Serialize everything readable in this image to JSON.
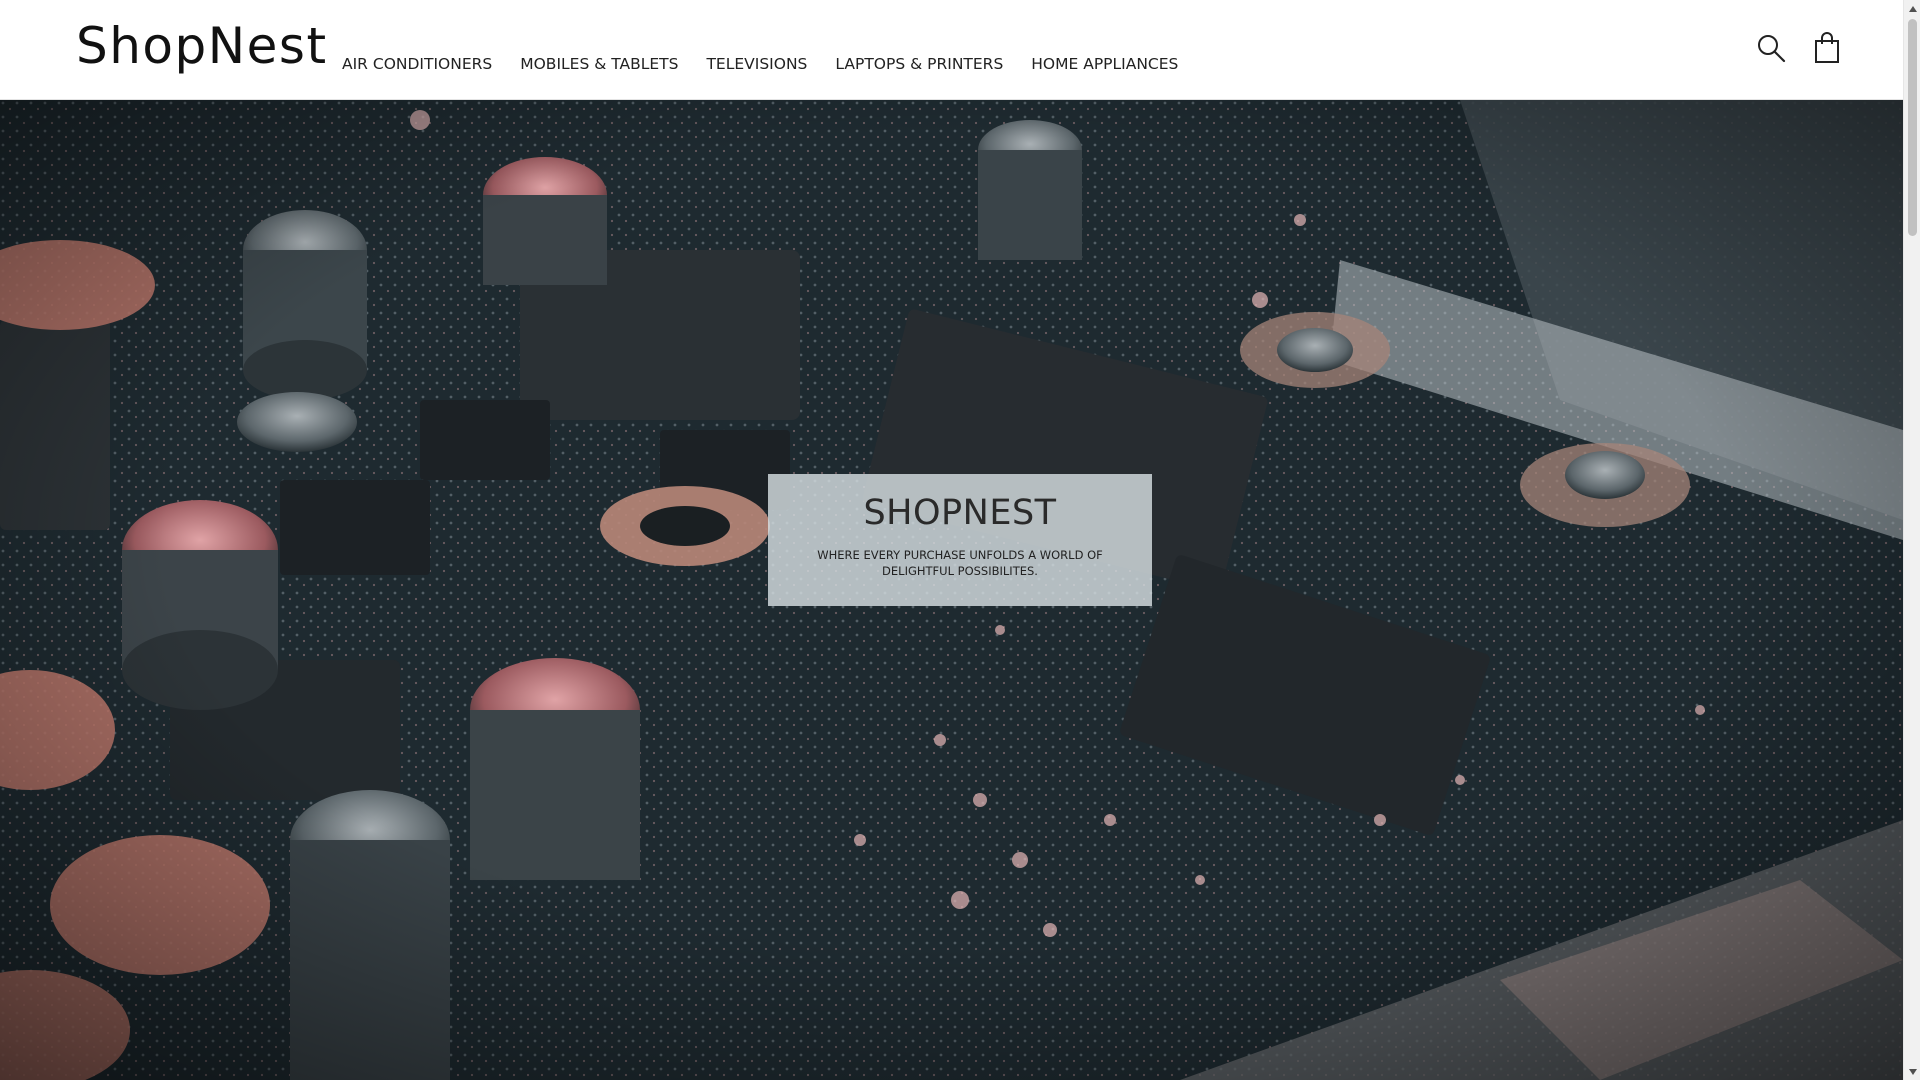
{
  "header": {
    "logo": "ShopNest",
    "nav": [
      "AIR CONDITIONERS",
      "MOBILES & TABLETS",
      "TELEVISIONS",
      "LAPTOPS & PRINTERS",
      "HOME APPLIANCES"
    ],
    "icons": [
      "search-icon",
      "shopping-bag-icon"
    ]
  },
  "hero": {
    "title": "SHOPNEST",
    "tagline": "WHERE EVERY PURCHASE UNFOLDS A WORLD OF DELIGHTFUL POSSIBILITES.",
    "background": "circuit-board-photo"
  },
  "colors": {
    "header_bg": "#ffffff",
    "text": "#222222",
    "card_bg": "#d6dee2"
  }
}
